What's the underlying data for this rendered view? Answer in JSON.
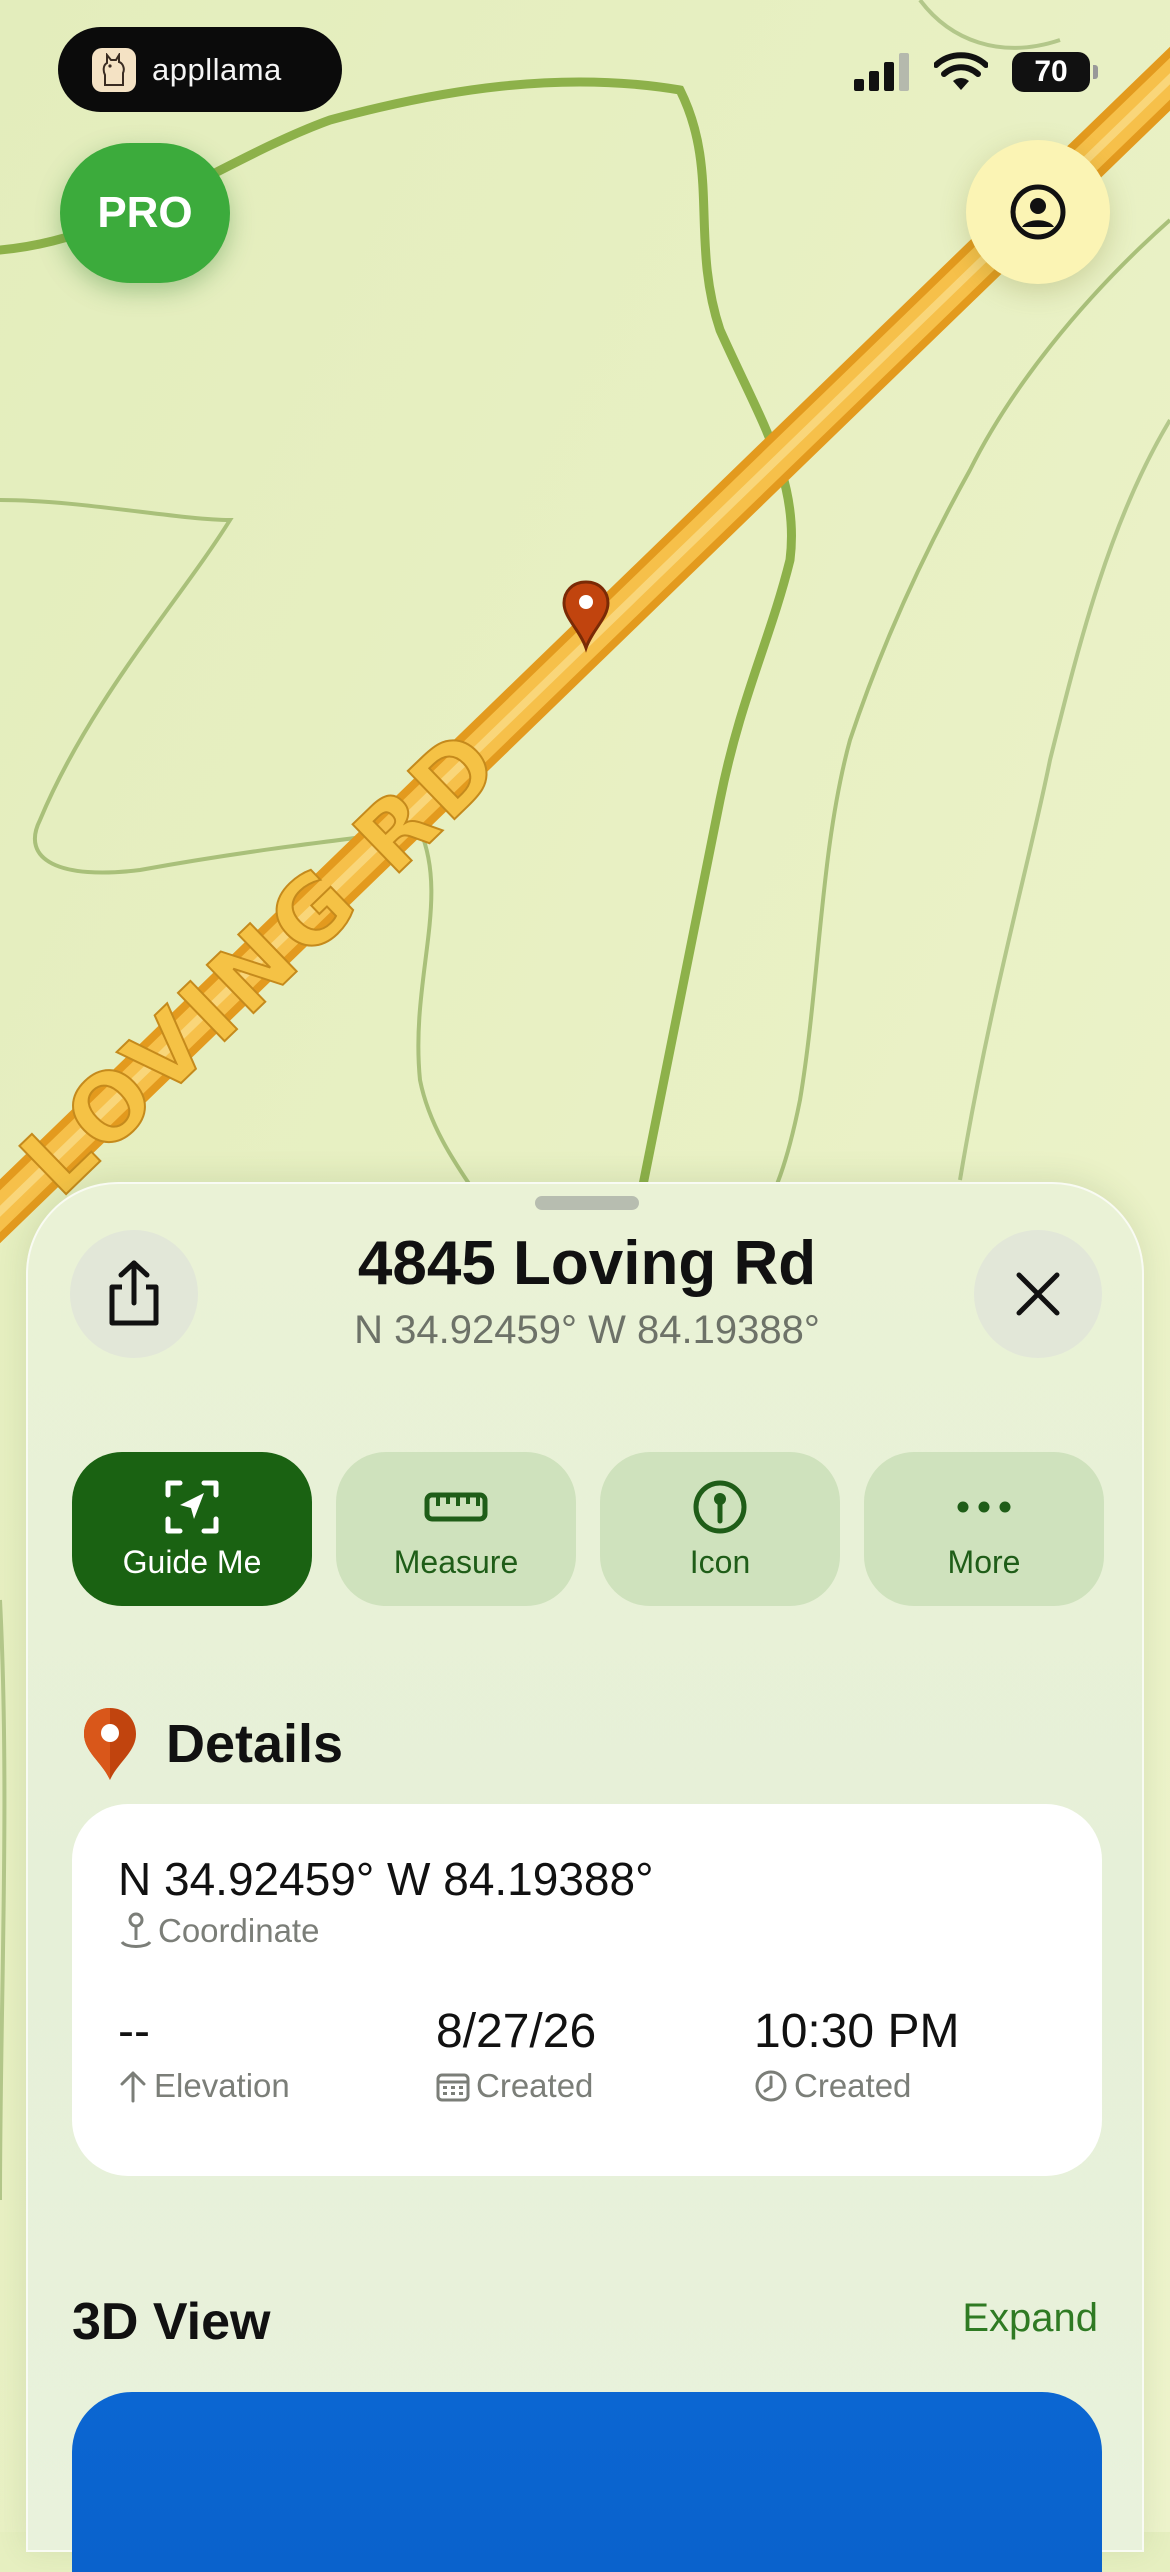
{
  "status_bar": {
    "brand": "appllama",
    "battery": "70"
  },
  "map": {
    "road_label": "LOVING RD"
  },
  "header_buttons": {
    "pro_label": "PRO"
  },
  "sheet": {
    "title": "4845 Loving Rd",
    "subtitle": "N 34.92459° W 84.19388°",
    "actions": [
      {
        "label": "Guide Me",
        "icon": "guide-arrow-icon"
      },
      {
        "label": "Measure",
        "icon": "ruler-icon"
      },
      {
        "label": "Icon",
        "icon": "pin-circle-icon"
      },
      {
        "label": "More",
        "icon": "ellipsis-icon"
      }
    ],
    "details": {
      "heading": "Details",
      "coordinate_value": "N 34.92459° W 84.19388°",
      "coordinate_label": "Coordinate",
      "elevation_value": "--",
      "elevation_label": "Elevation",
      "date_value": "8/27/26",
      "date_label": "Created",
      "time_value": "10:30 PM",
      "time_label": "Created"
    },
    "view_3d": {
      "title": "3D View",
      "expand": "Expand"
    }
  },
  "colors": {
    "map_bg": "#e6efc0",
    "road": "#f0b43a",
    "pro": "#3cab3c",
    "primary_action": "#1a6212",
    "secondary_action": "#cfe2bd",
    "pin": "#c1440e",
    "blue_panel": "#0b66d2"
  }
}
